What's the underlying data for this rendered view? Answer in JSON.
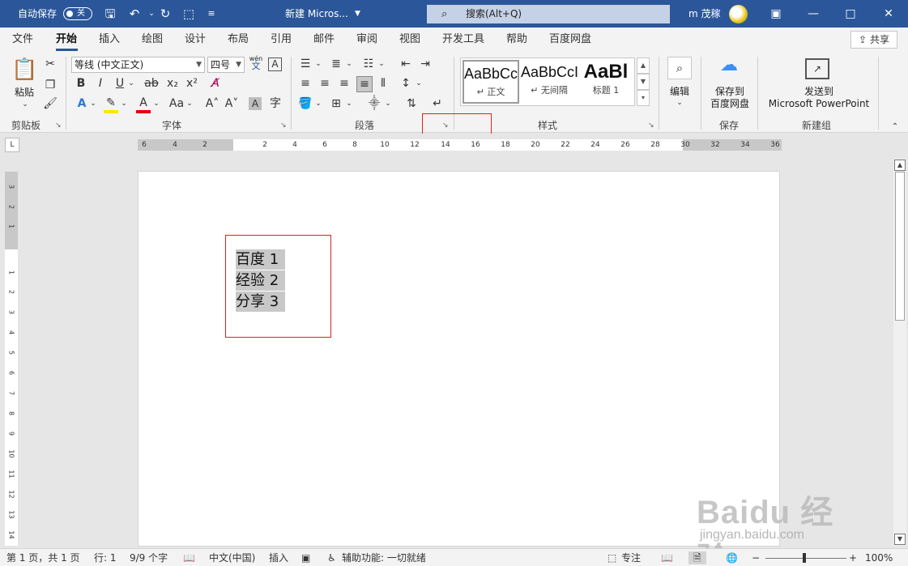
{
  "titlebar": {
    "autosave_label": "自动保存",
    "autosave_state": "关",
    "doc_title": "新建 Micros...",
    "search_placeholder": "搜索(Alt+Q)",
    "user_name": "m 茂稼",
    "accent_color": "#2b579a"
  },
  "ribbon_tabs": [
    "文件",
    "开始",
    "插入",
    "绘图",
    "设计",
    "布局",
    "引用",
    "邮件",
    "审阅",
    "视图",
    "开发工具",
    "帮助",
    "百度网盘"
  ],
  "active_tab": "开始",
  "share_label": "共享",
  "clipboard": {
    "paste_label": "粘贴",
    "group_label": "剪贴板"
  },
  "font": {
    "font_name": "等线 (中文正文)",
    "font_size": "四号",
    "phonetic_label": "wén",
    "phonetic_char": "文",
    "group_label": "字体"
  },
  "paragraph": {
    "group_label": "段落"
  },
  "styles": {
    "items": [
      {
        "sample": "AaBbCcI",
        "name": "↵ 正文"
      },
      {
        "sample": "AaBbCcI",
        "name": "↵ 无间隔"
      },
      {
        "sample": "AaBl",
        "name": "标题 1"
      }
    ],
    "group_label": "样式"
  },
  "editing": {
    "label": "编辑"
  },
  "save": {
    "label_line1": "保存到",
    "label_line2": "百度网盘",
    "group_label": "保存"
  },
  "new_group": {
    "label_line1": "发送到",
    "label_line2": "Microsoft PowerPoint",
    "group_label": "新建组"
  },
  "ruler": {
    "ticks": [
      "6",
      "4",
      "2",
      "2",
      "4",
      "6",
      "8",
      "10",
      "12",
      "14",
      "16",
      "18",
      "20",
      "22",
      "24",
      "26",
      "28",
      "30",
      "32",
      "34",
      "36"
    ]
  },
  "vertical_ruler": {
    "ticks": [
      "3",
      "2",
      "1",
      "1",
      "2",
      "3",
      "4",
      "5",
      "6",
      "7",
      "8",
      "9",
      "10",
      "11",
      "12",
      "13",
      "14"
    ]
  },
  "document": {
    "lines": [
      "百度 1",
      "经验 2",
      "分享 3"
    ]
  },
  "statusbar": {
    "page": "第 1 页，共 1 页",
    "line": "行: 1",
    "words": "9/9 个字",
    "language": "中文(中国)",
    "mode": "插入",
    "accessibility": "辅助功能: 一切就绪",
    "focus": "专注",
    "zoom": "100%"
  },
  "watermark": {
    "logo": "Baidu 经验",
    "url": "jingyan.baidu.com"
  }
}
